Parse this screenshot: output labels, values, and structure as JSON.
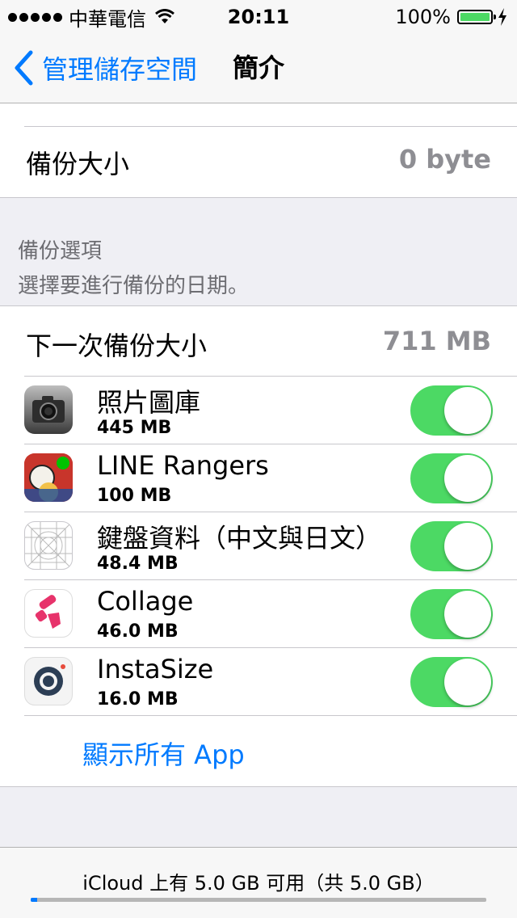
{
  "status_bar": {
    "carrier": "中華電信",
    "time": "20:11",
    "battery": "100%",
    "battery_icon": "battery-full-icon",
    "wifi_icon": "wifi-icon",
    "charging_icon": "bolt-icon"
  },
  "nav": {
    "back_label": "管理儲存空間",
    "title": "簡介"
  },
  "info": {
    "backup_size_label": "備份大小",
    "backup_size_value": "0 byte"
  },
  "backup_options": {
    "header": "備份選項",
    "subheader": "選擇要進行備份的日期。",
    "next_backup_label": "下一次備份大小",
    "next_backup_value": "711 MB"
  },
  "apps": [
    {
      "name": "照片圖庫",
      "size": "445 MB",
      "icon": "camera-icon",
      "enabled": true
    },
    {
      "name": "LINE Rangers",
      "size": "100 MB",
      "icon": "line-rangers-icon",
      "enabled": true
    },
    {
      "name": "鍵盤資料（中文與日文）",
      "size": "48.4 MB",
      "icon": "keyboard-data-icon",
      "enabled": true
    },
    {
      "name": "Collage",
      "size": "46.0 MB",
      "icon": "collage-icon",
      "enabled": true
    },
    {
      "name": "InstaSize",
      "size": "16.0 MB",
      "icon": "instasize-icon",
      "enabled": true
    }
  ],
  "show_all_label": "顯示所有 App",
  "footer": {
    "text": "iCloud 上有 5.0 GB 可用（共 5.0 GB）",
    "used_fraction": 0.015
  },
  "colors": {
    "accent": "#007aff",
    "toggle_on": "#4cd964"
  }
}
